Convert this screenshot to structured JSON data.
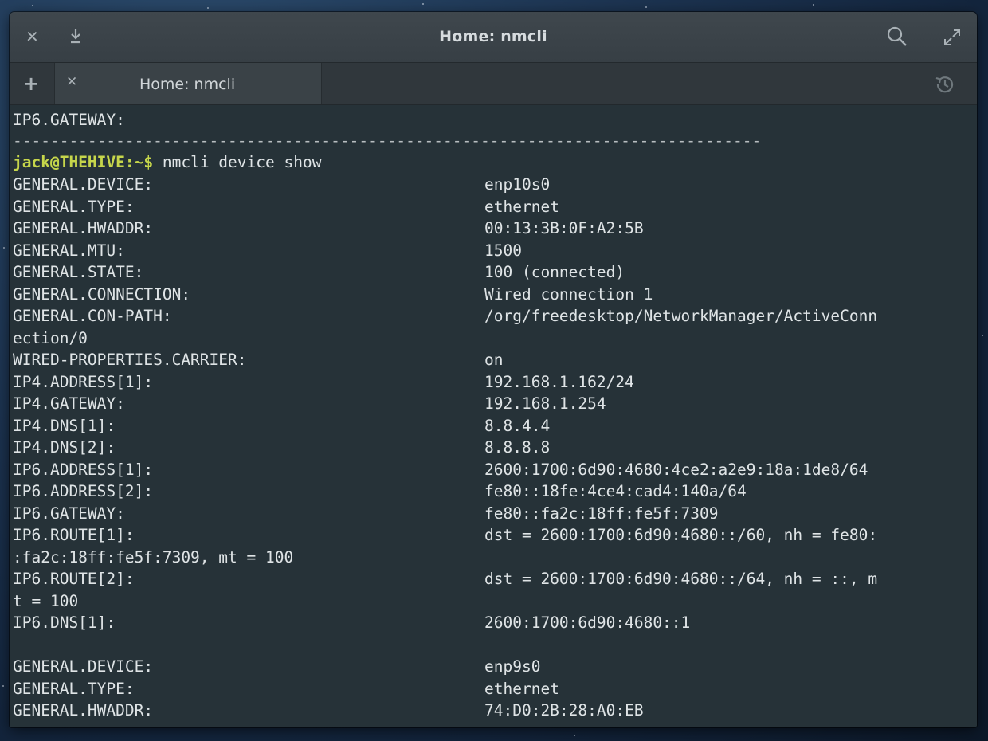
{
  "window": {
    "title": "Home: nmcli",
    "tab_label": "Home: nmcli"
  },
  "icons": {
    "close": "close-icon",
    "download": "download-icon",
    "search": "search-icon",
    "maximize": "maximize-icon",
    "new_tab": "plus-icon",
    "tab_close": "close-icon",
    "history": "history-icon"
  },
  "colors": {
    "terminal_bg": "#263238",
    "prompt": "#c6d64b",
    "text": "#dfe4e6"
  },
  "terminal": {
    "top_line": "IP6.GATEWAY:",
    "separator": "--------------------------------------------------------------------------------",
    "prompt_user": "jack@THEHIVE",
    "prompt_path": ":~$",
    "command": " nmcli device show",
    "rows": [
      {
        "key": "GENERAL.DEVICE:",
        "value": "enp10s0"
      },
      {
        "key": "GENERAL.TYPE:",
        "value": "ethernet"
      },
      {
        "key": "GENERAL.HWADDR:",
        "value": "00:13:3B:0F:A2:5B"
      },
      {
        "key": "GENERAL.MTU:",
        "value": "1500"
      },
      {
        "key": "GENERAL.STATE:",
        "value": "100 (connected)"
      },
      {
        "key": "GENERAL.CONNECTION:",
        "value": "Wired connection 1"
      },
      {
        "key": "GENERAL.CON-PATH:",
        "value": "/org/freedesktop/NetworkManager/ActiveConn"
      },
      {
        "key": "ection/0",
        "value": ""
      },
      {
        "key": "WIRED-PROPERTIES.CARRIER:",
        "value": "on"
      },
      {
        "key": "IP4.ADDRESS[1]:",
        "value": "192.168.1.162/24"
      },
      {
        "key": "IP4.GATEWAY:",
        "value": "192.168.1.254"
      },
      {
        "key": "IP4.DNS[1]:",
        "value": "8.8.4.4"
      },
      {
        "key": "IP4.DNS[2]:",
        "value": "8.8.8.8"
      },
      {
        "key": "IP6.ADDRESS[1]:",
        "value": "2600:1700:6d90:4680:4ce2:a2e9:18a:1de8/64"
      },
      {
        "key": "IP6.ADDRESS[2]:",
        "value": "fe80::18fe:4ce4:cad4:140a/64"
      },
      {
        "key": "IP6.GATEWAY:",
        "value": "fe80::fa2c:18ff:fe5f:7309"
      },
      {
        "key": "IP6.ROUTE[1]:",
        "value": "dst = 2600:1700:6d90:4680::/60, nh = fe80:"
      },
      {
        "key": ":fa2c:18ff:fe5f:7309, mt = 100",
        "value": ""
      },
      {
        "key": "IP6.ROUTE[2]:",
        "value": "dst = 2600:1700:6d90:4680::/64, nh = ::, m"
      },
      {
        "key": "t = 100",
        "value": ""
      },
      {
        "key": "IP6.DNS[1]:",
        "value": "2600:1700:6d90:4680::1"
      },
      {
        "key": "",
        "value": ""
      },
      {
        "key": "GENERAL.DEVICE:",
        "value": "enp9s0"
      },
      {
        "key": "GENERAL.TYPE:",
        "value": "ethernet"
      },
      {
        "key": "GENERAL.HWADDR:",
        "value": "74:D0:2B:28:A0:EB"
      }
    ]
  }
}
